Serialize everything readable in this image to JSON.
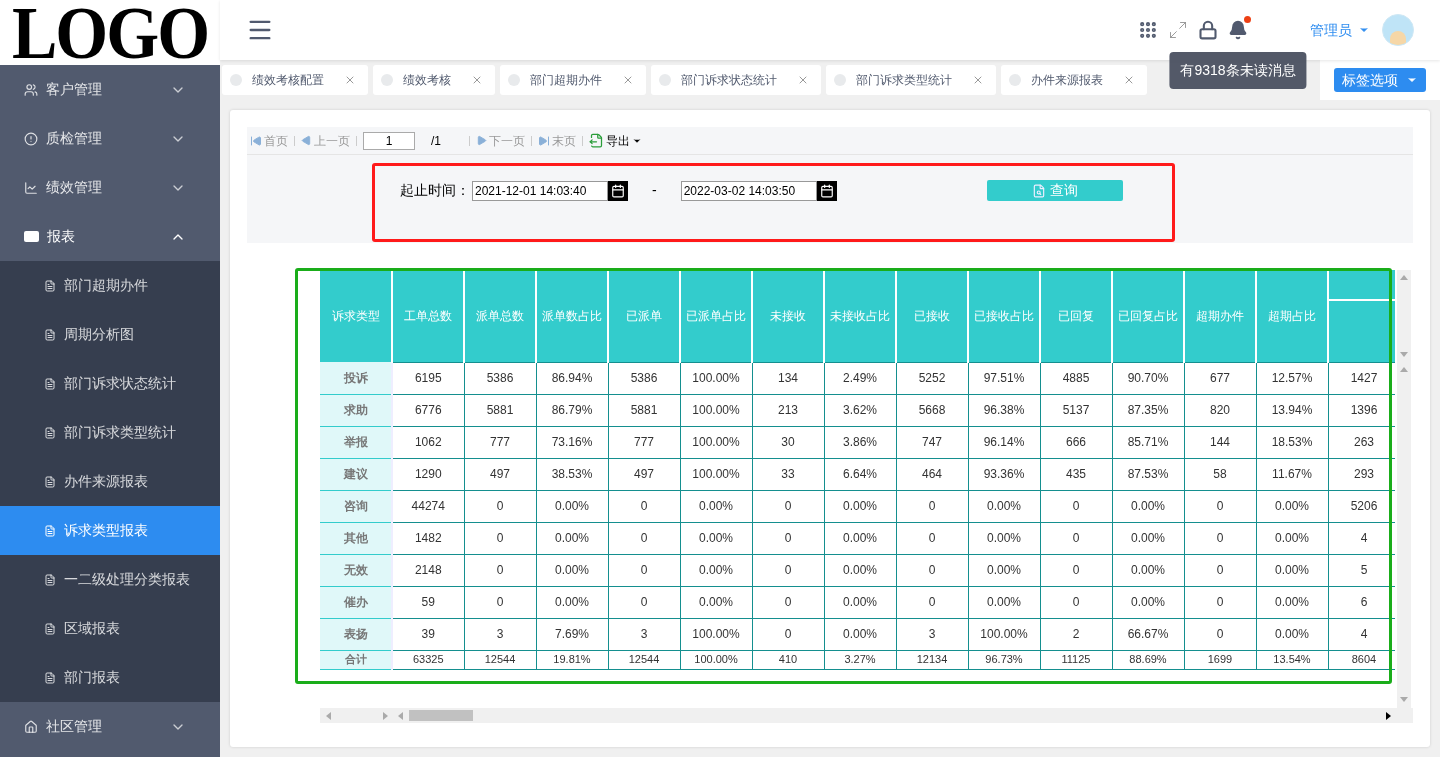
{
  "sidebar": {
    "logo": "LOGO",
    "items": [
      {
        "label": "客户管理",
        "expanded": false
      },
      {
        "label": "质检管理",
        "expanded": false
      },
      {
        "label": "绩效管理",
        "expanded": false
      },
      {
        "label": "报表",
        "expanded": true,
        "children": [
          {
            "label": "部门超期办件",
            "selected": false
          },
          {
            "label": "周期分析图",
            "selected": false
          },
          {
            "label": "部门诉求状态统计",
            "selected": false
          },
          {
            "label": "部门诉求类型统计",
            "selected": false
          },
          {
            "label": "办件来源报表",
            "selected": false
          },
          {
            "label": "诉求类型报表",
            "selected": true
          },
          {
            "label": "一二级处理分类报表",
            "selected": false
          },
          {
            "label": "区域报表",
            "selected": false
          },
          {
            "label": "部门报表",
            "selected": false
          }
        ]
      },
      {
        "label": "社区管理",
        "expanded": false
      }
    ]
  },
  "header": {
    "has_unread": true,
    "tooltip": "有9318条未读消息",
    "user": "管理员"
  },
  "tabs": [
    {
      "label": "绩效考核配置",
      "selected": false
    },
    {
      "label": "绩效考核",
      "selected": false
    },
    {
      "label": "部门超期办件",
      "selected": false
    },
    {
      "label": "部门诉求状态统计",
      "selected": false
    },
    {
      "label": "部门诉求类型统计",
      "selected": false
    },
    {
      "label": "办件来源报表",
      "selected": false
    }
  ],
  "tab_options": "标签选项",
  "pager": {
    "first": "首页",
    "prev": "上一页",
    "page": "1",
    "total": "/1",
    "next": "下一页",
    "last": "末页",
    "export": "导出"
  },
  "filter": {
    "label": "起止时间：",
    "start": "2021-12-01 14:03:40",
    "separator": "-",
    "end": "2022-03-02 14:03:50",
    "query": "查询"
  },
  "table": {
    "columns": [
      "诉求类型",
      "工单总数",
      "派单总数",
      "派单数占比",
      "已派单",
      "已派单占比",
      "未接收",
      "未接收占比",
      "已接收",
      "已接收占比",
      "已回复",
      "已回复占比",
      "超期办件",
      "超期占比"
    ],
    "rows": [
      {
        "kind": "data",
        "cells": [
          "投诉",
          "6195",
          "5386",
          "86.94%",
          "5386",
          "100.00%",
          "134",
          "2.49%",
          "5252",
          "97.51%",
          "4885",
          "90.70%",
          "677",
          "12.57%",
          "1427"
        ]
      },
      {
        "kind": "data",
        "cells": [
          "求助",
          "6776",
          "5881",
          "86.79%",
          "5881",
          "100.00%",
          "213",
          "3.62%",
          "5668",
          "96.38%",
          "5137",
          "87.35%",
          "820",
          "13.94%",
          "1396"
        ]
      },
      {
        "kind": "data",
        "cells": [
          "举报",
          "1062",
          "777",
          "73.16%",
          "777",
          "100.00%",
          "30",
          "3.86%",
          "747",
          "96.14%",
          "666",
          "85.71%",
          "144",
          "18.53%",
          "263"
        ]
      },
      {
        "kind": "data",
        "cells": [
          "建议",
          "1290",
          "497",
          "38.53%",
          "497",
          "100.00%",
          "33",
          "6.64%",
          "464",
          "93.36%",
          "435",
          "87.53%",
          "58",
          "11.67%",
          "293"
        ]
      },
      {
        "kind": "data",
        "cells": [
          "咨询",
          "44274",
          "0",
          "0.00%",
          "0",
          "0.00%",
          "0",
          "0.00%",
          "0",
          "0.00%",
          "0",
          "0.00%",
          "0",
          "0.00%",
          "5206"
        ]
      },
      {
        "kind": "data",
        "cells": [
          "其他",
          "1482",
          "0",
          "0.00%",
          "0",
          "0.00%",
          "0",
          "0.00%",
          "0",
          "0.00%",
          "0",
          "0.00%",
          "0",
          "0.00%",
          "4"
        ]
      },
      {
        "kind": "data",
        "cells": [
          "无效",
          "2148",
          "0",
          "0.00%",
          "0",
          "0.00%",
          "0",
          "0.00%",
          "0",
          "0.00%",
          "0",
          "0.00%",
          "0",
          "0.00%",
          "5"
        ]
      },
      {
        "kind": "data",
        "cells": [
          "催办",
          "59",
          "0",
          "0.00%",
          "0",
          "0.00%",
          "0",
          "0.00%",
          "0",
          "0.00%",
          "0",
          "0.00%",
          "0",
          "0.00%",
          "6"
        ]
      },
      {
        "kind": "data",
        "cells": [
          "表扬",
          "39",
          "3",
          "7.69%",
          "3",
          "100.00%",
          "0",
          "0.00%",
          "3",
          "100.00%",
          "2",
          "66.67%",
          "0",
          "0.00%",
          "4"
        ]
      },
      {
        "kind": "total",
        "cells": [
          "合计",
          "63325",
          "12544",
          "19.81%",
          "12544",
          "100.00%",
          "410",
          "3.27%",
          "12134",
          "96.73%",
          "11125",
          "88.69%",
          "1699",
          "13.54%",
          "8604"
        ]
      }
    ]
  }
}
